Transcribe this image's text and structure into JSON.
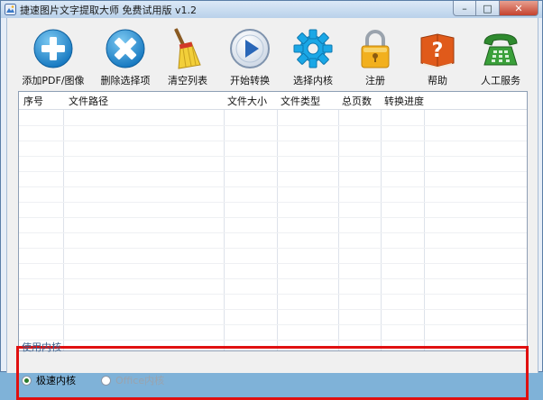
{
  "window": {
    "title": "捷速图片文字提取大师 免费试用版 v1.2",
    "buttons": {
      "minimize": "–",
      "maximize": "□",
      "close": "✕"
    }
  },
  "toolbar": {
    "items": [
      {
        "label": "添加PDF/图像",
        "icon": "add-icon",
        "color": "#1b8fd6"
      },
      {
        "label": "删除选择项",
        "icon": "delete-icon",
        "color": "#1b8fd6"
      },
      {
        "label": "清空列表",
        "icon": "broom-icon",
        "color": "#e8c23a"
      },
      {
        "label": "开始转换",
        "icon": "play-icon",
        "color": "#2a67b8"
      },
      {
        "label": "选择内核",
        "icon": "gear-icon",
        "color": "#1aa7e6"
      },
      {
        "label": "注册",
        "icon": "lock-icon",
        "color": "#f0a81c"
      },
      {
        "label": "帮助",
        "icon": "help-book-icon",
        "color": "#e05a1a"
      },
      {
        "label": "人工服务",
        "icon": "phone-icon",
        "color": "#2f8a2f"
      }
    ]
  },
  "table": {
    "columns": [
      "序号",
      "文件路径",
      "文件大小",
      "文件类型",
      "总页数",
      "转换进度"
    ],
    "rows": []
  },
  "engine": {
    "section_label": "使用内核",
    "options": [
      {
        "label": "极速内核",
        "selected": true
      },
      {
        "label": "Office内核",
        "selected": false
      }
    ]
  }
}
